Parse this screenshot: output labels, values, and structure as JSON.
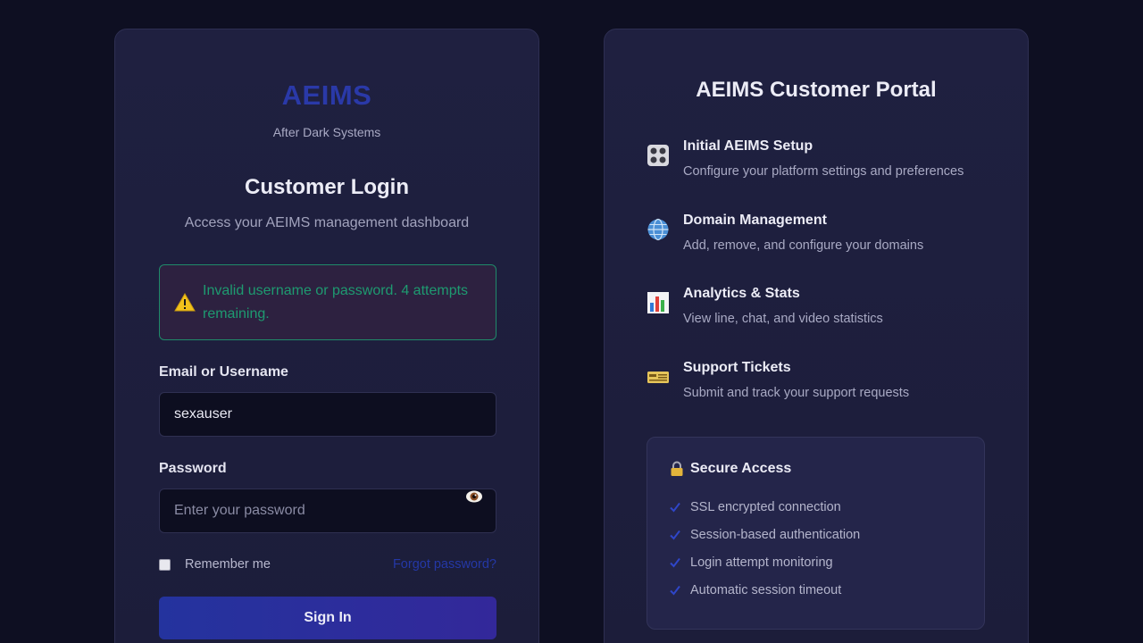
{
  "login": {
    "brand": "AEIMS",
    "brand_sub": "After Dark Systems",
    "title": "Customer Login",
    "subtitle": "Access your AEIMS management dashboard",
    "alert_icon": "warning-icon",
    "alert_message": "Invalid username or password. 4 attempts remaining.",
    "email_label": "Email or Username",
    "email_value": "sexauser",
    "password_label": "Password",
    "password_placeholder": "Enter your password",
    "remember_label": "Remember me",
    "forgot_label": "Forgot password?",
    "signin_label": "Sign In"
  },
  "portal": {
    "title": "AEIMS Customer Portal",
    "features": [
      {
        "icon": "control-panel-icon",
        "title": "Initial AEIMS Setup",
        "desc": "Configure your platform settings and preferences"
      },
      {
        "icon": "globe-icon",
        "title": "Domain Management",
        "desc": "Add, remove, and configure your domains"
      },
      {
        "icon": "bar-chart-icon",
        "title": "Analytics & Stats",
        "desc": "View line, chat, and video statistics"
      },
      {
        "icon": "ticket-icon",
        "title": "Support Tickets",
        "desc": "Submit and track your support requests"
      }
    ],
    "secure": {
      "title": "Secure Access",
      "items": [
        "SSL encrypted connection",
        "Session-based authentication",
        "Login attempt monitoring",
        "Automatic session timeout"
      ]
    }
  },
  "colors": {
    "background": "#0e0f22",
    "card": "#1f2040",
    "brand": "#2a39a8",
    "alert_text": "#1e9a70",
    "alert_border": "#1f8a6a",
    "link": "#2438a6",
    "button": "#24339e"
  }
}
